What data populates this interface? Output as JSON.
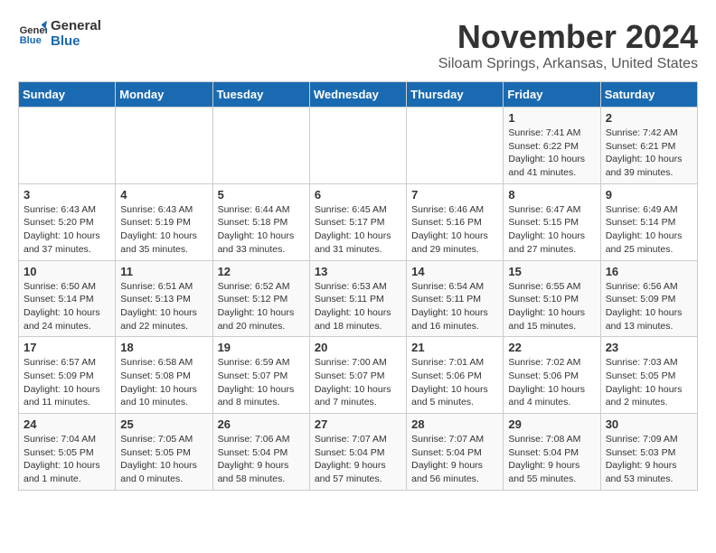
{
  "logo": {
    "line1": "General",
    "line2": "Blue"
  },
  "title": "November 2024",
  "subtitle": "Siloam Springs, Arkansas, United States",
  "days_of_week": [
    "Sunday",
    "Monday",
    "Tuesday",
    "Wednesday",
    "Thursday",
    "Friday",
    "Saturday"
  ],
  "weeks": [
    [
      {
        "day": "",
        "info": ""
      },
      {
        "day": "",
        "info": ""
      },
      {
        "day": "",
        "info": ""
      },
      {
        "day": "",
        "info": ""
      },
      {
        "day": "",
        "info": ""
      },
      {
        "day": "1",
        "info": "Sunrise: 7:41 AM\nSunset: 6:22 PM\nDaylight: 10 hours\nand 41 minutes."
      },
      {
        "day": "2",
        "info": "Sunrise: 7:42 AM\nSunset: 6:21 PM\nDaylight: 10 hours\nand 39 minutes."
      }
    ],
    [
      {
        "day": "3",
        "info": "Sunrise: 6:43 AM\nSunset: 5:20 PM\nDaylight: 10 hours\nand 37 minutes."
      },
      {
        "day": "4",
        "info": "Sunrise: 6:43 AM\nSunset: 5:19 PM\nDaylight: 10 hours\nand 35 minutes."
      },
      {
        "day": "5",
        "info": "Sunrise: 6:44 AM\nSunset: 5:18 PM\nDaylight: 10 hours\nand 33 minutes."
      },
      {
        "day": "6",
        "info": "Sunrise: 6:45 AM\nSunset: 5:17 PM\nDaylight: 10 hours\nand 31 minutes."
      },
      {
        "day": "7",
        "info": "Sunrise: 6:46 AM\nSunset: 5:16 PM\nDaylight: 10 hours\nand 29 minutes."
      },
      {
        "day": "8",
        "info": "Sunrise: 6:47 AM\nSunset: 5:15 PM\nDaylight: 10 hours\nand 27 minutes."
      },
      {
        "day": "9",
        "info": "Sunrise: 6:49 AM\nSunset: 5:14 PM\nDaylight: 10 hours\nand 25 minutes."
      }
    ],
    [
      {
        "day": "10",
        "info": "Sunrise: 6:50 AM\nSunset: 5:14 PM\nDaylight: 10 hours\nand 24 minutes."
      },
      {
        "day": "11",
        "info": "Sunrise: 6:51 AM\nSunset: 5:13 PM\nDaylight: 10 hours\nand 22 minutes."
      },
      {
        "day": "12",
        "info": "Sunrise: 6:52 AM\nSunset: 5:12 PM\nDaylight: 10 hours\nand 20 minutes."
      },
      {
        "day": "13",
        "info": "Sunrise: 6:53 AM\nSunset: 5:11 PM\nDaylight: 10 hours\nand 18 minutes."
      },
      {
        "day": "14",
        "info": "Sunrise: 6:54 AM\nSunset: 5:11 PM\nDaylight: 10 hours\nand 16 minutes."
      },
      {
        "day": "15",
        "info": "Sunrise: 6:55 AM\nSunset: 5:10 PM\nDaylight: 10 hours\nand 15 minutes."
      },
      {
        "day": "16",
        "info": "Sunrise: 6:56 AM\nSunset: 5:09 PM\nDaylight: 10 hours\nand 13 minutes."
      }
    ],
    [
      {
        "day": "17",
        "info": "Sunrise: 6:57 AM\nSunset: 5:09 PM\nDaylight: 10 hours\nand 11 minutes."
      },
      {
        "day": "18",
        "info": "Sunrise: 6:58 AM\nSunset: 5:08 PM\nDaylight: 10 hours\nand 10 minutes."
      },
      {
        "day": "19",
        "info": "Sunrise: 6:59 AM\nSunset: 5:07 PM\nDaylight: 10 hours\nand 8 minutes."
      },
      {
        "day": "20",
        "info": "Sunrise: 7:00 AM\nSunset: 5:07 PM\nDaylight: 10 hours\nand 7 minutes."
      },
      {
        "day": "21",
        "info": "Sunrise: 7:01 AM\nSunset: 5:06 PM\nDaylight: 10 hours\nand 5 minutes."
      },
      {
        "day": "22",
        "info": "Sunrise: 7:02 AM\nSunset: 5:06 PM\nDaylight: 10 hours\nand 4 minutes."
      },
      {
        "day": "23",
        "info": "Sunrise: 7:03 AM\nSunset: 5:05 PM\nDaylight: 10 hours\nand 2 minutes."
      }
    ],
    [
      {
        "day": "24",
        "info": "Sunrise: 7:04 AM\nSunset: 5:05 PM\nDaylight: 10 hours\nand 1 minute."
      },
      {
        "day": "25",
        "info": "Sunrise: 7:05 AM\nSunset: 5:05 PM\nDaylight: 10 hours\nand 0 minutes."
      },
      {
        "day": "26",
        "info": "Sunrise: 7:06 AM\nSunset: 5:04 PM\nDaylight: 9 hours\nand 58 minutes."
      },
      {
        "day": "27",
        "info": "Sunrise: 7:07 AM\nSunset: 5:04 PM\nDaylight: 9 hours\nand 57 minutes."
      },
      {
        "day": "28",
        "info": "Sunrise: 7:07 AM\nSunset: 5:04 PM\nDaylight: 9 hours\nand 56 minutes."
      },
      {
        "day": "29",
        "info": "Sunrise: 7:08 AM\nSunset: 5:04 PM\nDaylight: 9 hours\nand 55 minutes."
      },
      {
        "day": "30",
        "info": "Sunrise: 7:09 AM\nSunset: 5:03 PM\nDaylight: 9 hours\nand 53 minutes."
      }
    ]
  ]
}
